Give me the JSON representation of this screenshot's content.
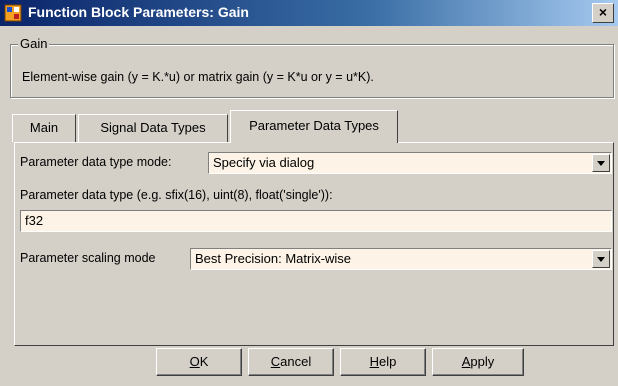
{
  "window": {
    "title": "Function Block Parameters: Gain",
    "close_glyph": "×",
    "icon": "simulink-block-icon"
  },
  "group": {
    "title": "Gain",
    "description": "Element-wise gain (y = K.*u) or matrix gain (y = K*u or y = u*K)."
  },
  "tabs": [
    {
      "label": "Main",
      "active": false
    },
    {
      "label": "Signal Data Types",
      "active": false
    },
    {
      "label": "Parameter Data Types",
      "active": true
    }
  ],
  "panel": {
    "mode_label": "Parameter data type mode:",
    "mode_value": "Specify via dialog",
    "type_label": "Parameter data type (e.g. sfix(16), uint(8), float('single')):",
    "type_value": "f32",
    "scaling_label": "Parameter scaling mode",
    "scaling_value": "Best Precision: Matrix-wise"
  },
  "buttons": {
    "ok": {
      "accel": "O",
      "rest": "K"
    },
    "cancel": {
      "accel": "C",
      "rest": "ancel"
    },
    "help": {
      "accel": "H",
      "rest": "elp"
    },
    "apply": {
      "accel": "A",
      "rest": "pply"
    }
  },
  "colors": {
    "dialog_bg": "#d4d0c8",
    "field_bg": "#fdf3e6",
    "title_gradient_start": "#0a246a",
    "title_gradient_end": "#a6caf0"
  }
}
